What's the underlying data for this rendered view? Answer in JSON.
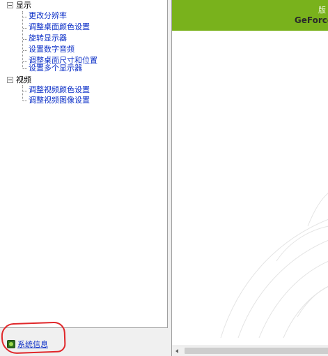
{
  "tree": {
    "display": {
      "label": "显示",
      "items": [
        "更改分辨率",
        "调整桌面颜色设置",
        "旋转显示器",
        "设置数字音频",
        "调整桌面尺寸和位置",
        "设置多个显示器"
      ]
    },
    "video": {
      "label": "视频",
      "items": [
        "调整视频颜色设置",
        "调整视频图像设置"
      ]
    }
  },
  "footer": {
    "system_info": "系统信息",
    "system_info_icon": "nvidia-info-icon",
    "annotation_color": "#e0272a"
  },
  "banner": {
    "top_text": "版",
    "product": "GeForce",
    "color": "#79b21c"
  }
}
